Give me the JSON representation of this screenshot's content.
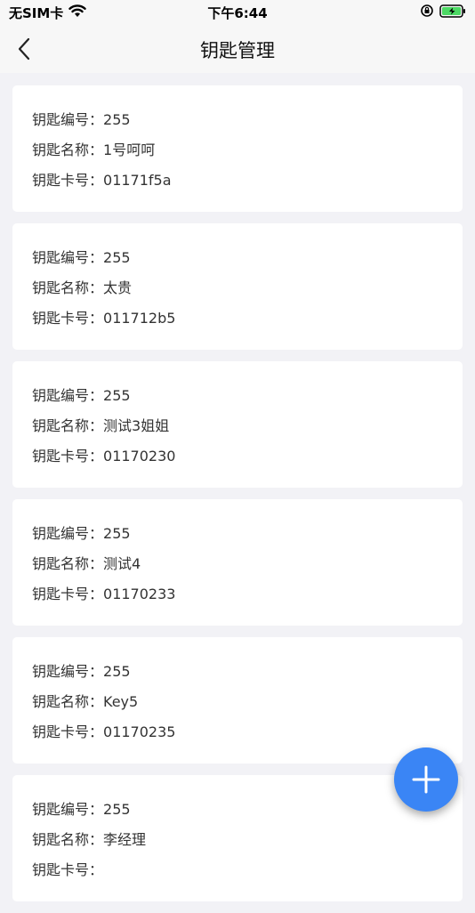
{
  "status": {
    "carrier": "无SIM卡",
    "time": "下午6:44"
  },
  "nav": {
    "title": "钥匙管理"
  },
  "labels": {
    "number": "钥匙编号：",
    "name": "钥匙名称：",
    "card": "钥匙卡号："
  },
  "keys": [
    {
      "number": "255",
      "name": "1号呵呵",
      "card": "01171f5a"
    },
    {
      "number": "255",
      "name": "太贵",
      "card": "011712b5"
    },
    {
      "number": "255",
      "name": "测试3姐姐",
      "card": "01170230"
    },
    {
      "number": "255",
      "name": "测试4",
      "card": "01170233"
    },
    {
      "number": "255",
      "name": "Key5",
      "card": "01170235"
    },
    {
      "number": "255",
      "name": "李经理",
      "card": ""
    }
  ],
  "colors": {
    "accent": "#3a85f5",
    "background": "#f2f2f6",
    "battery": "#4cd964"
  }
}
